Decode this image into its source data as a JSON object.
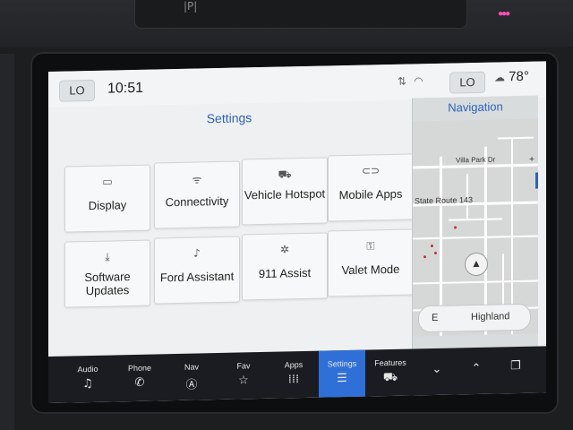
{
  "status_bar": {
    "left_temp": "LO",
    "time": "10:51",
    "right_temp": "LO",
    "outside_temp": "78°",
    "icons": [
      "signal-icon",
      "wifi-icon"
    ]
  },
  "settings": {
    "title": "Settings",
    "tiles": [
      {
        "label": "Display",
        "icon": "display-icon"
      },
      {
        "label": "Connectivity",
        "icon": "wifi-icon"
      },
      {
        "label": "Vehicle Hotspot",
        "icon": "car-wifi-icon"
      },
      {
        "label": "Mobile Apps",
        "icon": "link-icon"
      },
      {
        "label": "Software Updates",
        "icon": "download-icon"
      },
      {
        "label": "Ford Assistant",
        "icon": "voice-icon"
      },
      {
        "label": "911 Assist",
        "icon": "emergency-icon"
      },
      {
        "label": "Valet Mode",
        "icon": "lock-car-icon"
      }
    ]
  },
  "navigation": {
    "title": "Navigation",
    "map_labels": {
      "park": "Villa Park Dr",
      "route": "State Route 143"
    },
    "street_direction": "E",
    "street_name": "Highland"
  },
  "dock": {
    "items": [
      {
        "label": "Audio",
        "icon": "music-note-icon"
      },
      {
        "label": "Phone",
        "icon": "phone-icon"
      },
      {
        "label": "Nav",
        "icon": "compass-icon"
      },
      {
        "label": "Fav",
        "icon": "star-icon"
      },
      {
        "label": "Apps",
        "icon": "grid-icon"
      },
      {
        "label": "Settings",
        "icon": "sliders-icon",
        "active": true
      },
      {
        "label": "Features",
        "icon": "truck-icon"
      },
      {
        "label": "",
        "icon": "chevron-down-icon"
      },
      {
        "label": "",
        "icon": "chevron-up-icon"
      },
      {
        "label": "",
        "icon": "copy-icon"
      }
    ]
  },
  "colors": {
    "accent": "#2d63b6",
    "dock_active": "#2f6fd8",
    "dock_bg": "#1a1c21"
  }
}
